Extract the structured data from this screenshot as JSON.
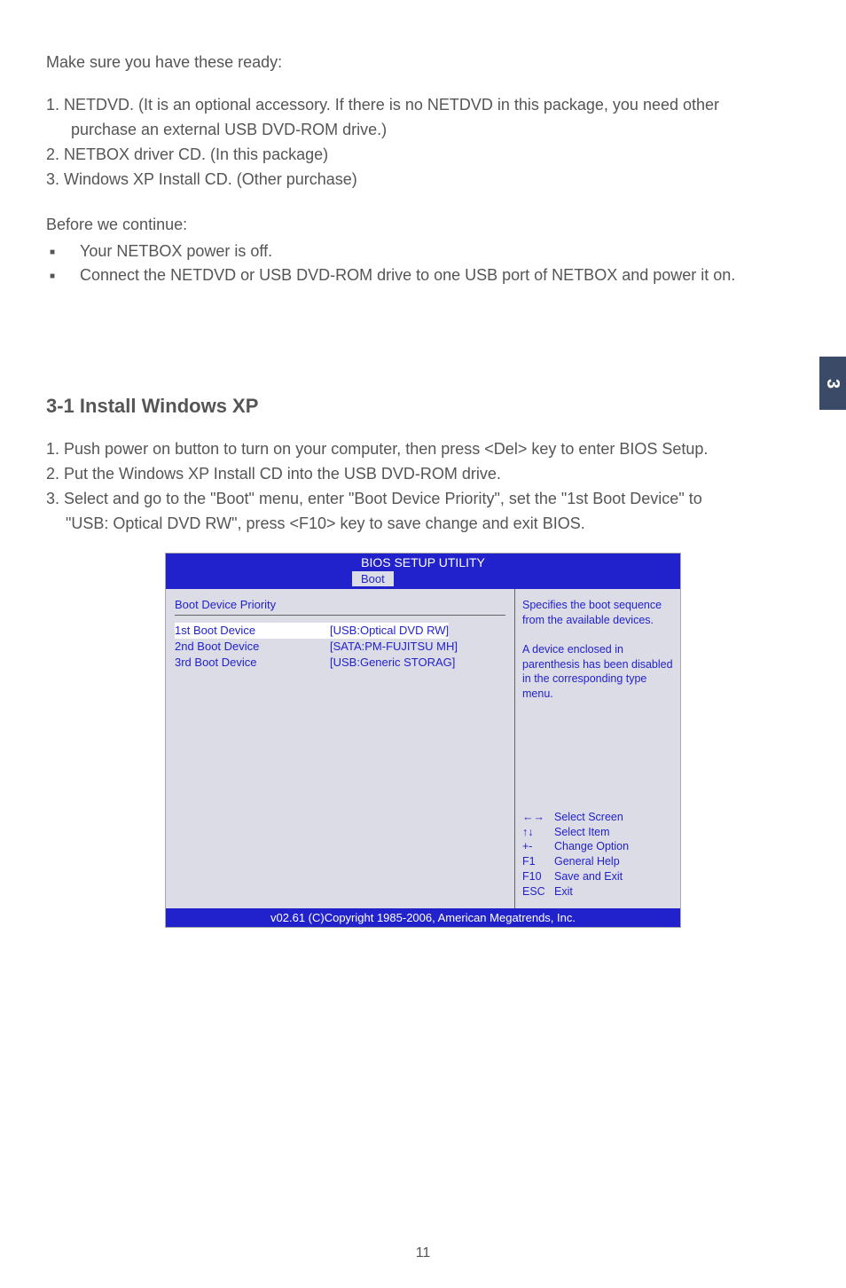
{
  "intro": "Make sure you have these ready:",
  "ready_list": {
    "item1_line1": "1. NETDVD. (It is an optional accessory. If there is no NETDVD in this package, you need other",
    "item1_line2": "purchase an external USB DVD-ROM drive.)",
    "item2": "2. NETBOX driver CD. (In this package)",
    "item3": "3. Windows XP Install CD. (Other purchase)"
  },
  "before_heading": "Before we continue:",
  "bullets": {
    "b1": "Your NETBOX power is off.",
    "b2": "Connect the NETDVD or USB DVD-ROM drive to one USB port of NETBOX and power it on."
  },
  "side_tab": "3",
  "section_heading": "3-1 Install Windows XP",
  "steps": {
    "s1": "1. Push power on button to turn on your computer, then press <Del> key to enter BIOS Setup.",
    "s2": "2. Put the Windows XP Install CD into the USB DVD-ROM drive.",
    "s3_line1": "3. Select and go to the \"Boot\" menu, enter \"Boot Device Priority\", set the \"1st Boot Device\" to",
    "s3_line2": "\"USB: Optical DVD RW\", press <F10> key to save change and exit BIOS."
  },
  "bios": {
    "title": "BIOS SETUP UTILITY",
    "tab": "Boot",
    "left_header": "Boot Device Priority",
    "devices": [
      {
        "label": "1st Boot Device",
        "value": "[USB:Optical DVD RW]"
      },
      {
        "label": "2nd Boot Device",
        "value": "[SATA:PM-FUJITSU MH]"
      },
      {
        "label": "3rd Boot Device",
        "value": "[USB:Generic STORAG]"
      }
    ],
    "help_line1": "Specifies the boot sequence from the available devices.",
    "help_line2": "A device enclosed in parenthesis has been disabled in the corresponding type menu.",
    "keys": [
      {
        "k": "←→",
        "d": "Select Screen"
      },
      {
        "k": "↑↓",
        "d": "Select Item"
      },
      {
        "k": "+-",
        "d": "Change Option"
      },
      {
        "k": "F1",
        "d": "General Help"
      },
      {
        "k": "F10",
        "d": "Save and Exit"
      },
      {
        "k": "ESC",
        "d": "Exit"
      }
    ],
    "footer": "v02.61  (C)Copyright 1985-2006, American Megatrends, Inc."
  },
  "page_number": "11"
}
